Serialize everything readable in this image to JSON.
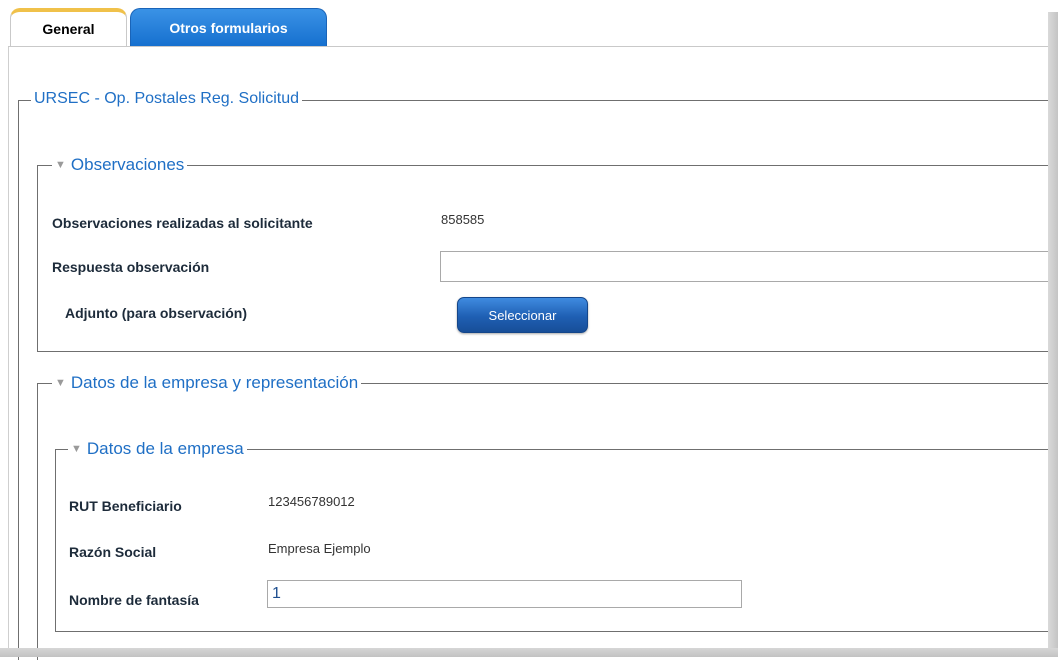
{
  "tabs": [
    {
      "label": "General",
      "active": true
    },
    {
      "label": "Otros formularios",
      "active": false
    }
  ],
  "form": {
    "title": "URSEC - Op. Postales Reg. Solicitud",
    "observaciones": {
      "legend": "Observaciones",
      "realizadas_label": "Observaciones realizadas al solicitante",
      "realizadas_value": "858585",
      "respuesta_label": "Respuesta observación",
      "respuesta_value": "",
      "adjunto_label": "Adjunto (para observación)",
      "seleccionar_button": "Seleccionar"
    },
    "datos_empresa_representacion": {
      "legend": "Datos de la empresa y representación",
      "datos_empresa": {
        "legend": "Datos de la empresa",
        "rut_label": "RUT Beneficiario",
        "rut_value": "123456789012",
        "razon_label": "Razón Social",
        "razon_value": "Empresa Ejemplo",
        "fantasia_label": "Nombre de fantasía",
        "fantasia_value": "1"
      }
    }
  },
  "colors": {
    "accent_blue": "#1f6fc5",
    "tab_active_top": "#f0c14a",
    "button_blue": "#1f5fb3"
  }
}
